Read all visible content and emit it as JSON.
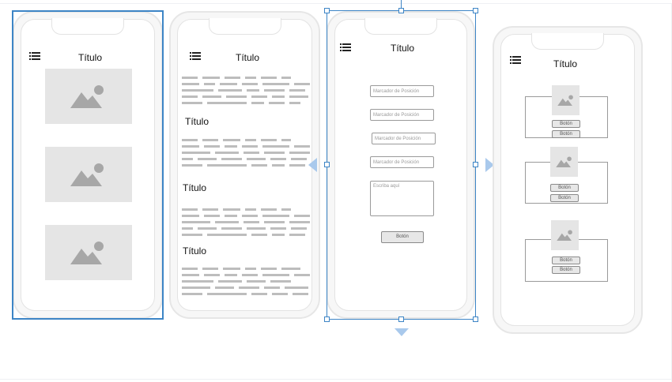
{
  "screens": [
    {
      "title": "Título",
      "menu_icon": "hamburger-list-icon",
      "image_icon": "image-placeholder-icon",
      "selected": true
    },
    {
      "title": "Título",
      "sections": [
        {
          "title": ""
        },
        {
          "title": "Título"
        },
        {
          "title": "Título"
        },
        {
          "title": "Título"
        }
      ]
    },
    {
      "title": "Título",
      "inputs": [
        {
          "placeholder": "Marcador de Posición"
        },
        {
          "placeholder": "Marcador de Posición"
        },
        {
          "placeholder": "Marcador de Posición"
        },
        {
          "placeholder": "Marcador de Posición"
        }
      ],
      "textarea_placeholder": "Escriba aquí",
      "button_label": "Botón",
      "selected": true
    },
    {
      "title": "Título",
      "cards": [
        {
          "buttons": [
            "Botón",
            "Botón"
          ]
        },
        {
          "buttons": [
            "Botón",
            "Botón"
          ]
        },
        {
          "buttons": [
            "Botón",
            "Botón"
          ]
        }
      ]
    }
  ],
  "colors": {
    "selection": "#3d85c6",
    "arrow": "#a9c9ec",
    "placeholder_image": "#e5e5e5",
    "text_lines": "#bdbdbd"
  }
}
